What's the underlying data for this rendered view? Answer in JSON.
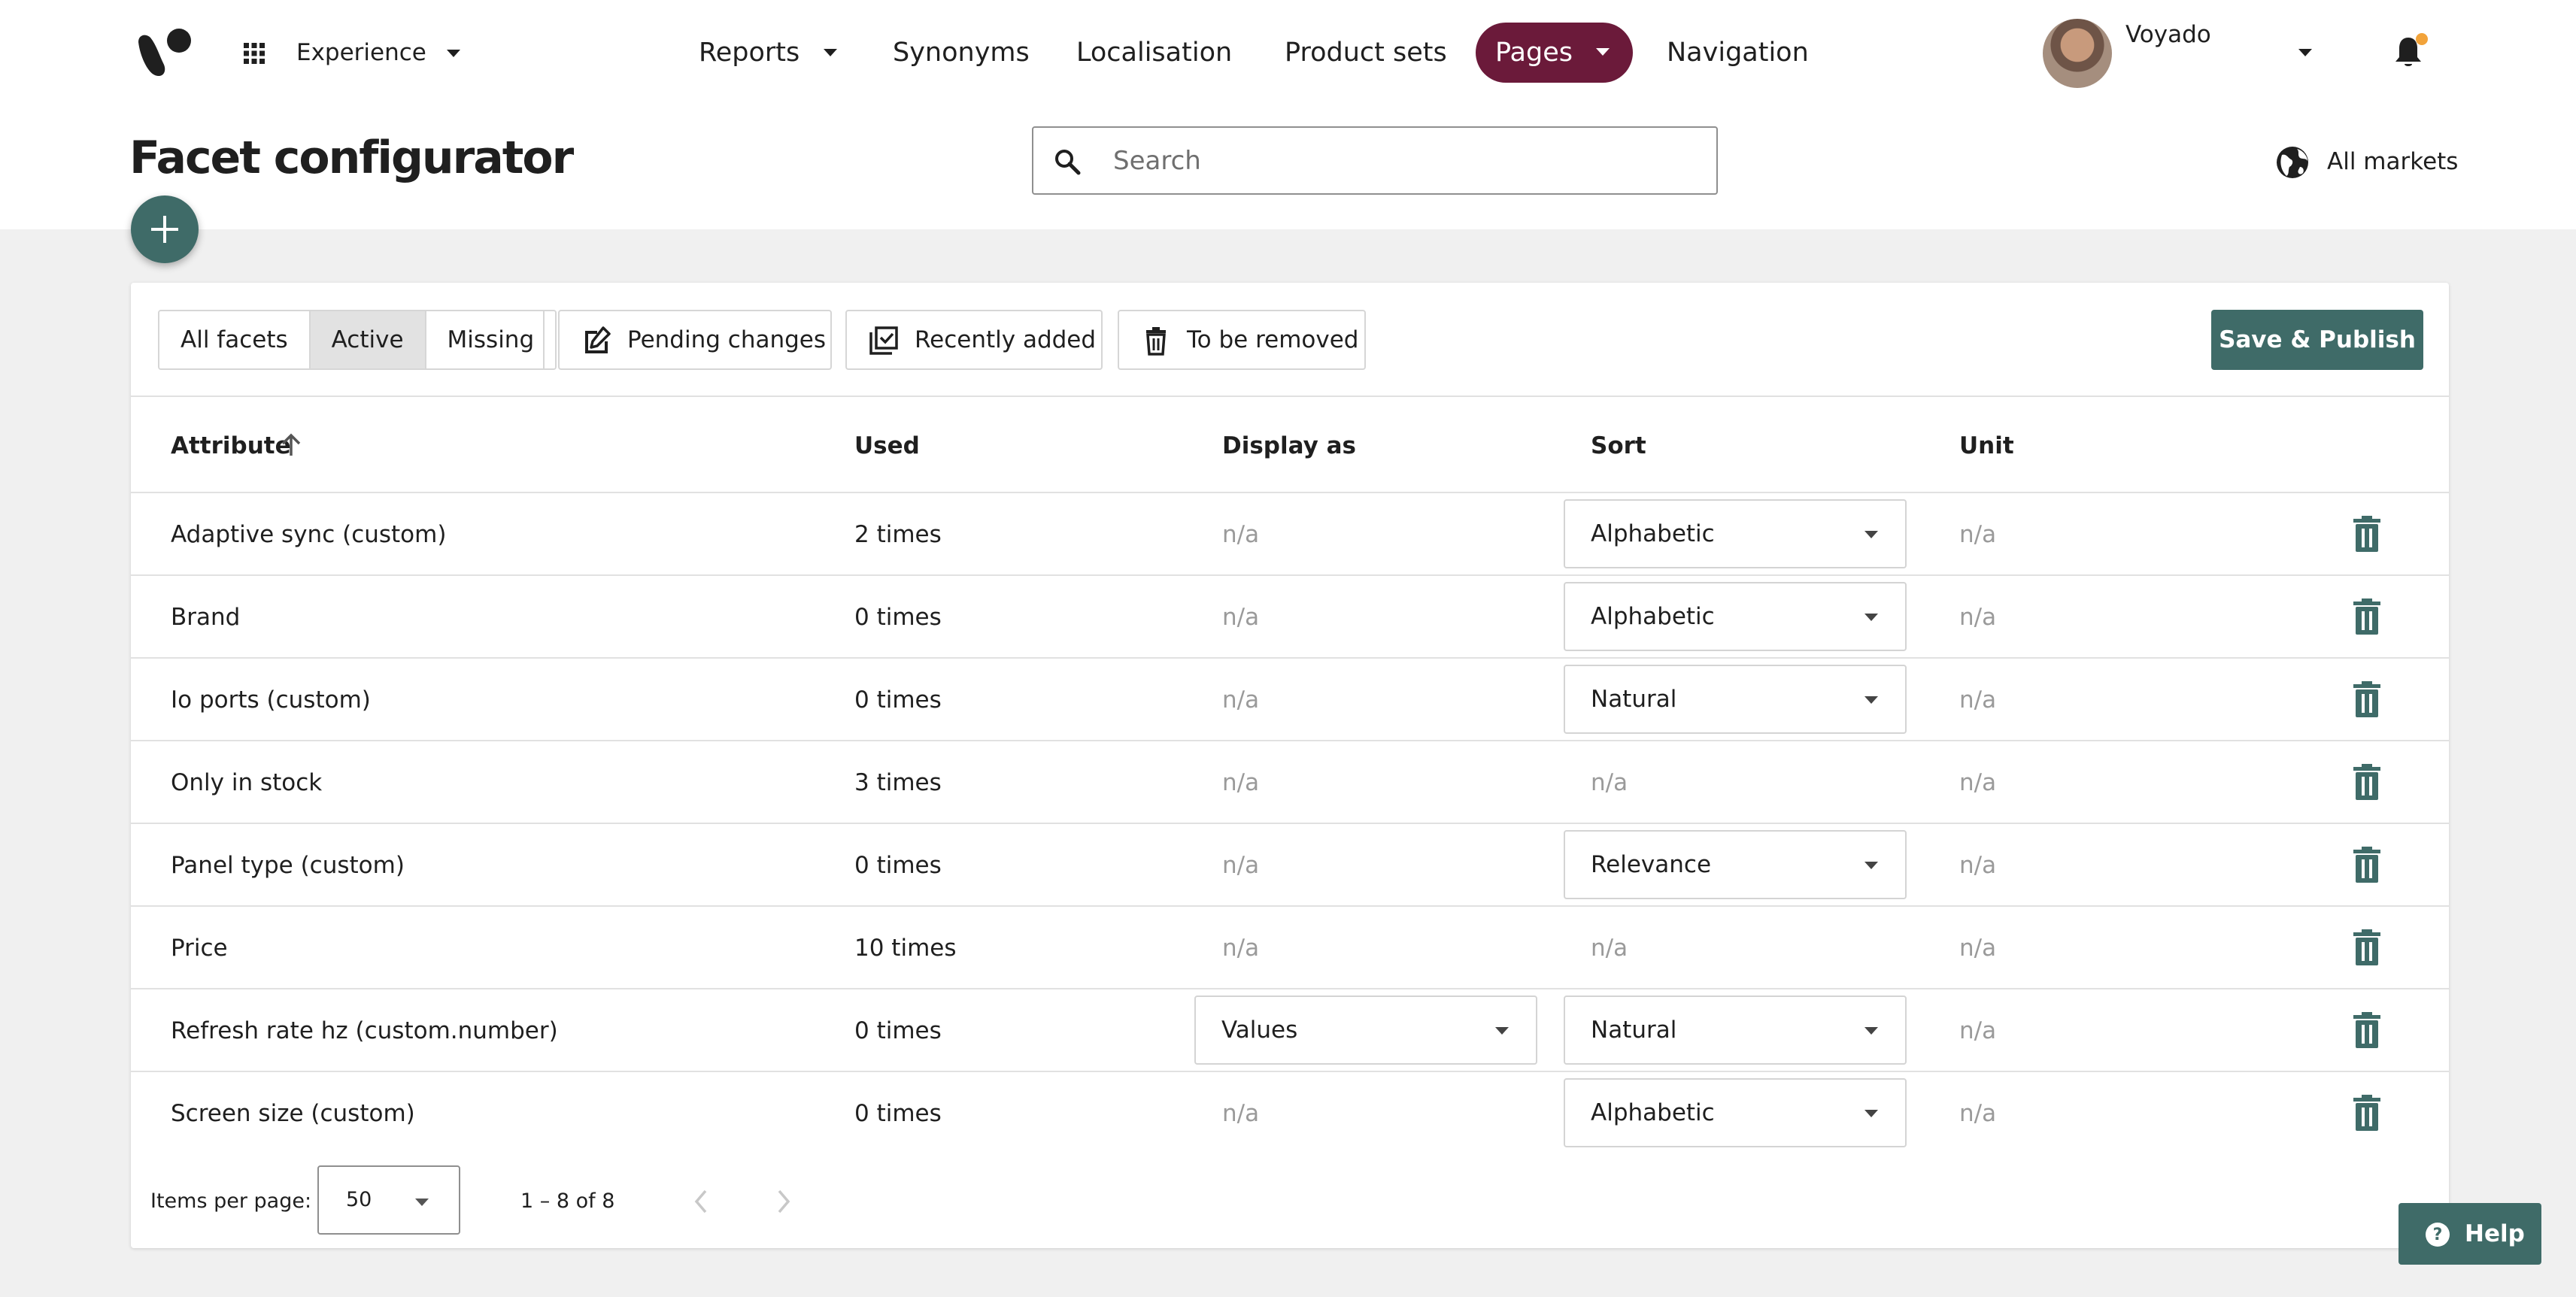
{
  "header": {
    "app_switcher_label": "Experience",
    "nav": {
      "reports": "Reports",
      "synonyms": "Synonyms",
      "localisation": "Localisation",
      "product_sets": "Product sets",
      "pages": "Pages",
      "navigation": "Navigation"
    },
    "active_nav": "Pages",
    "user_name": "Voyado",
    "notification_dot_color": "#f2a33a",
    "accent_color": "#6b1a3a"
  },
  "page": {
    "title": "Facet configurator",
    "search_placeholder": "Search",
    "markets_label": "All markets"
  },
  "toolbar": {
    "filters": [
      "All facets",
      "Active",
      "Missing"
    ],
    "active_filter": "Active",
    "pending_changes": "Pending changes",
    "recently_added": "Recently added",
    "to_be_removed": "To be removed",
    "save_publish": "Save & Publish",
    "primary_color": "#3f6b68"
  },
  "table": {
    "headers": {
      "attribute": "Attribute",
      "used": "Used",
      "display_as": "Display as",
      "sort": "Sort",
      "unit": "Unit"
    },
    "sorted_by": "Attribute",
    "sort_direction": "ascending",
    "rows": [
      {
        "attribute": "Adaptive sync (custom)",
        "used": "2 times",
        "display_as": "n/a",
        "sort": "Alphabetic",
        "unit": "n/a"
      },
      {
        "attribute": "Brand",
        "used": "0 times",
        "display_as": "n/a",
        "sort": "Alphabetic",
        "unit": "n/a"
      },
      {
        "attribute": "Io ports (custom)",
        "used": "0 times",
        "display_as": "n/a",
        "sort": "Natural",
        "unit": "n/a"
      },
      {
        "attribute": "Only in stock",
        "used": "3 times",
        "display_as": "n/a",
        "sort": "n/a",
        "unit": "n/a"
      },
      {
        "attribute": "Panel type (custom)",
        "used": "0 times",
        "display_as": "n/a",
        "sort": "Relevance",
        "unit": "n/a"
      },
      {
        "attribute": "Price",
        "used": "10 times",
        "display_as": "n/a",
        "sort": "n/a",
        "unit": "n/a"
      },
      {
        "attribute": "Refresh rate hz (custom.number)",
        "used": "0 times",
        "display_as": "Values",
        "sort": "Natural",
        "unit": "n/a"
      },
      {
        "attribute": "Screen size (custom)",
        "used": "0 times",
        "display_as": "n/a",
        "sort": "Alphabetic",
        "unit": "n/a"
      }
    ]
  },
  "pagination": {
    "items_per_page_label": "Items per page:",
    "items_per_page": "50",
    "range": "1 – 8 of 8"
  },
  "help": {
    "label": "Help"
  },
  "icons": [
    "logo-icon",
    "apps-grid-icon",
    "bell-icon",
    "search-icon",
    "globe-icon",
    "plus-icon",
    "edit-icon",
    "checklist-icon",
    "trash-icon",
    "arrow-up-icon",
    "chevron-left-icon",
    "chevron-right-icon",
    "help-icon"
  ]
}
